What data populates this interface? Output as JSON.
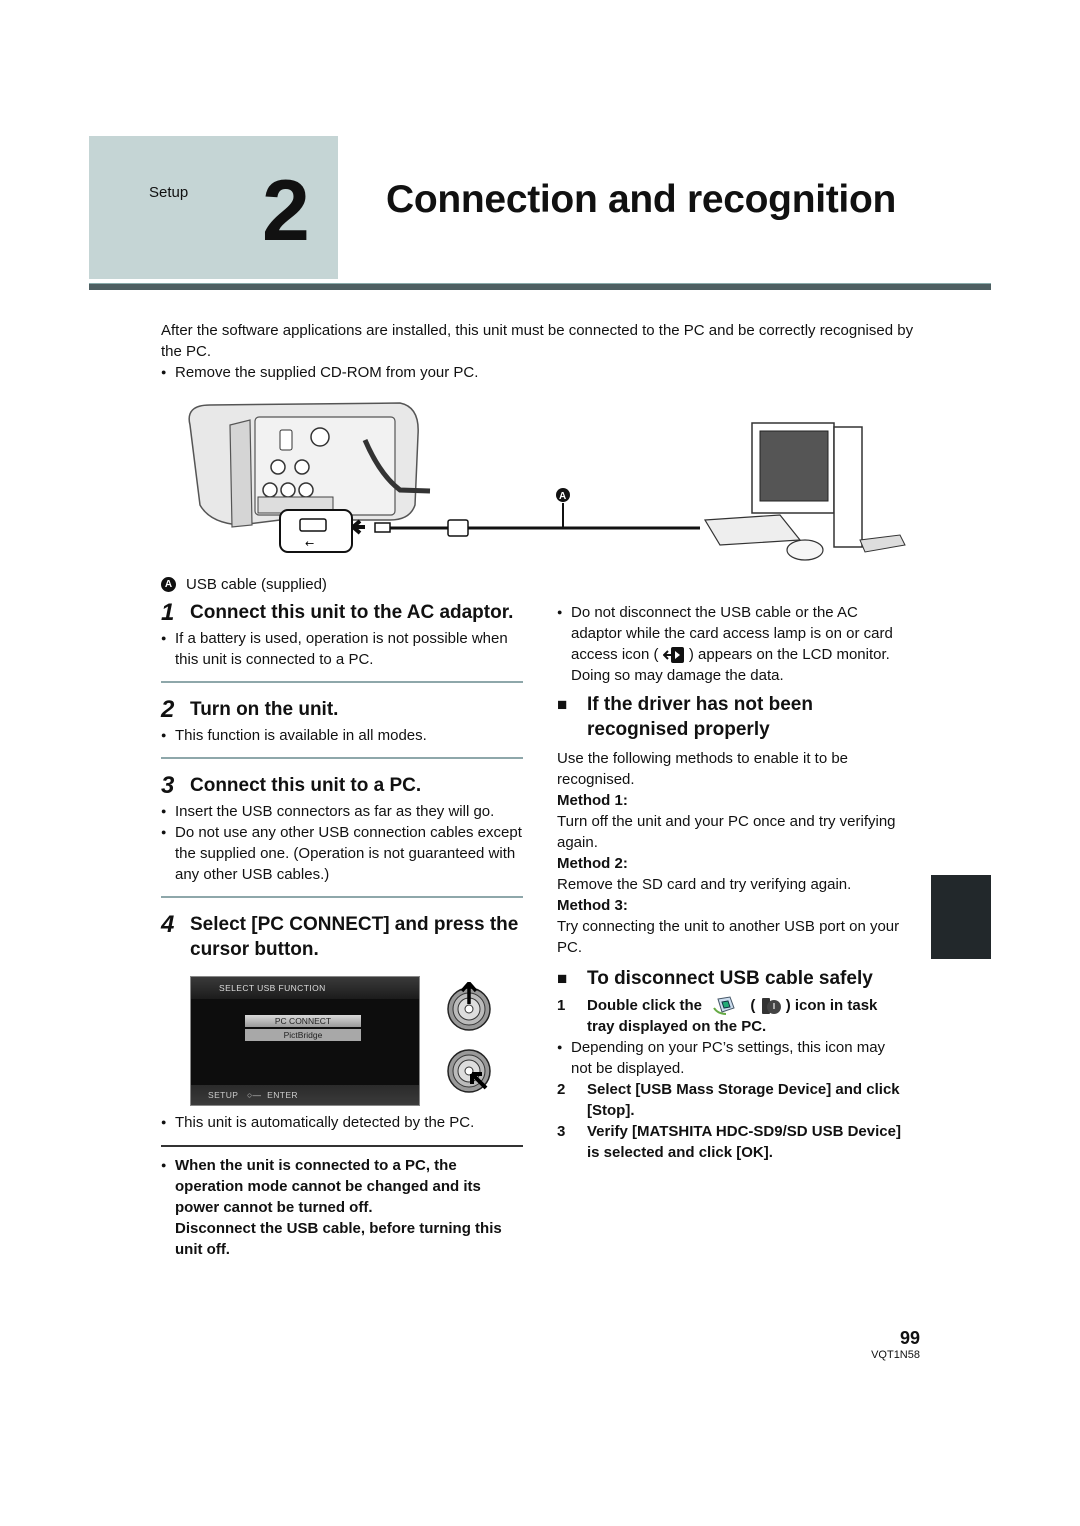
{
  "header": {
    "section": "Setup",
    "chapter_number": "2",
    "title": "Connection and recognition"
  },
  "intro": {
    "paragraph": "After the software applications are installed, this unit must be connected to the PC and be correctly recognised by the PC.",
    "bullet": "Remove the supplied CD-ROM from your PC."
  },
  "illustration": {
    "callout_marker": "A",
    "caption": "USB cable (supplied)"
  },
  "steps": [
    {
      "number": "1",
      "title": "Connect this unit to the AC adaptor.",
      "bullets": [
        "If a battery is used, operation is not possible when this unit is connected to a PC."
      ]
    },
    {
      "number": "2",
      "title": "Turn on the unit.",
      "bullets": [
        "This function is available in all modes."
      ]
    },
    {
      "number": "3",
      "title": "Connect this unit to a PC.",
      "bullets": [
        "Insert the USB connectors as far as they will go.",
        "Do not use any other USB connection cables except the supplied one. (Operation is not guaranteed with any other USB cables.)"
      ]
    },
    {
      "number": "4",
      "title": "Select [PC CONNECT] and press the cursor button.",
      "bullets": [
        "This unit is automatically detected by the PC."
      ]
    }
  ],
  "lcd_screen": {
    "title": "SELECT USB FUNCTION",
    "options": [
      "PC CONNECT",
      "PictBridge"
    ],
    "selected": "PC CONNECT",
    "footer_left": "SETUP",
    "footer_right": "ENTER"
  },
  "warning": {
    "line1": "When the unit is connected to a PC, the operation mode cannot be changed and its power cannot be turned off.",
    "line2": "Disconnect the USB cable, before turning this unit off."
  },
  "right_column": {
    "card_warning_before": "Do not disconnect the USB cable or the AC adaptor while the card access lamp is on or card access icon (",
    "card_warning_after": ") appears on the LCD monitor. Doing so may damage the data.",
    "driver_section": {
      "title": "If the driver has not been recognised properly",
      "intro": "Use the following methods to enable it to be recognised.",
      "methods": [
        {
          "label": "Method 1:",
          "text": "Turn off the unit and your PC once and try verifying again."
        },
        {
          "label": "Method 2:",
          "text": "Remove the SD card and try verifying again."
        },
        {
          "label": "Method 3:",
          "text": "Try connecting the unit to another USB port on your PC."
        }
      ]
    },
    "disconnect_section": {
      "title": "To disconnect USB cable safely",
      "step1_before": "Double click the",
      "step1_mid": "(",
      "step1_after": ") icon in task tray displayed on the PC.",
      "step1_note": "Depending on your PC’s settings, this icon may not be displayed.",
      "step2": "Select [USB Mass Storage Device] and click [Stop].",
      "step3": "Verify [MATSHITA HDC-SD9/SD USB Device] is selected and click [OK].",
      "numbers": [
        "1",
        "2",
        "3"
      ]
    }
  },
  "footer": {
    "page_number": "99",
    "doc_code": "VQT1N58"
  },
  "colors": {
    "header_box": "#c5d5d5",
    "header_rule": "#4e5f62",
    "section_rule": "#8ea7aa",
    "side_tab": "#22282b"
  }
}
